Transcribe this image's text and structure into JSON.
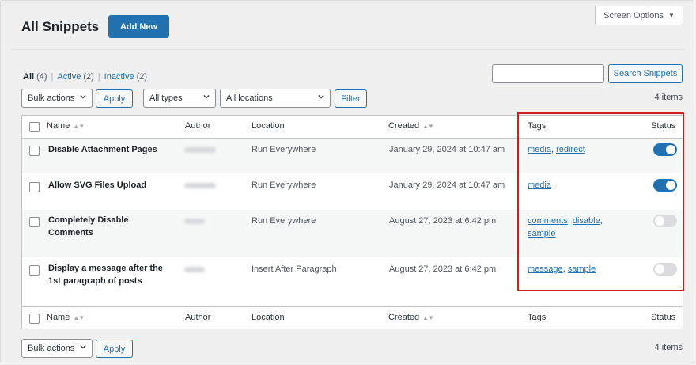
{
  "screen_options": {
    "label": "Screen Options",
    "caret": "▼"
  },
  "page": {
    "title": "All Snippets",
    "add_new": "Add New"
  },
  "filters": {
    "all": {
      "label": "All",
      "count": "(4)"
    },
    "active": {
      "label": "Active",
      "count": "(2)"
    },
    "inactive": {
      "label": "Inactive",
      "count": "(2)"
    },
    "separator": "|"
  },
  "search": {
    "value": "",
    "button": "Search Snippets"
  },
  "tablenav_top": {
    "bulk_actions": "Bulk actions",
    "apply": "Apply",
    "types": "All types",
    "locations": "All locations",
    "filter": "Filter",
    "items": "4 items"
  },
  "columns": {
    "name": "Name",
    "author": "Author",
    "location": "Location",
    "created": "Created",
    "tags": "Tags",
    "status": "Status"
  },
  "rows": [
    {
      "name": "Disable Attachment Pages",
      "location": "Run Everywhere",
      "created": "January 29, 2024 at 10:47 am",
      "tags": [
        "media",
        "redirect"
      ],
      "active": true
    },
    {
      "name": "Allow SVG Files Upload",
      "location": "Run Everywhere",
      "created": "January 29, 2024 at 10:47 am",
      "tags": [
        "media"
      ],
      "active": true
    },
    {
      "name_line1": "Completely Disable",
      "name_line2": "Comments",
      "location": "Run Everywhere",
      "created": "August 27, 2023 at 6:42 pm",
      "tags": [
        "comments",
        "disable",
        "sample"
      ],
      "active": false
    },
    {
      "name_line1": "Display a message after the",
      "name_line2": "1st paragraph of posts",
      "location": "Insert After Paragraph",
      "created": "August 27, 2023 at 6:42 pm",
      "tags": [
        "message",
        "sample"
      ],
      "active": false
    }
  ],
  "tablenav_bottom": {
    "bulk_actions": "Bulk actions",
    "apply": "Apply",
    "items": "4 items"
  },
  "colors": {
    "primary": "#2271b1",
    "highlight": "#cc1f1f",
    "toggle_off": "#dcdcde"
  },
  "icons": {
    "sort": "sort-arrows-icon",
    "dropdown": "chevron-down-icon",
    "toggle": "toggle-switch-icon"
  }
}
